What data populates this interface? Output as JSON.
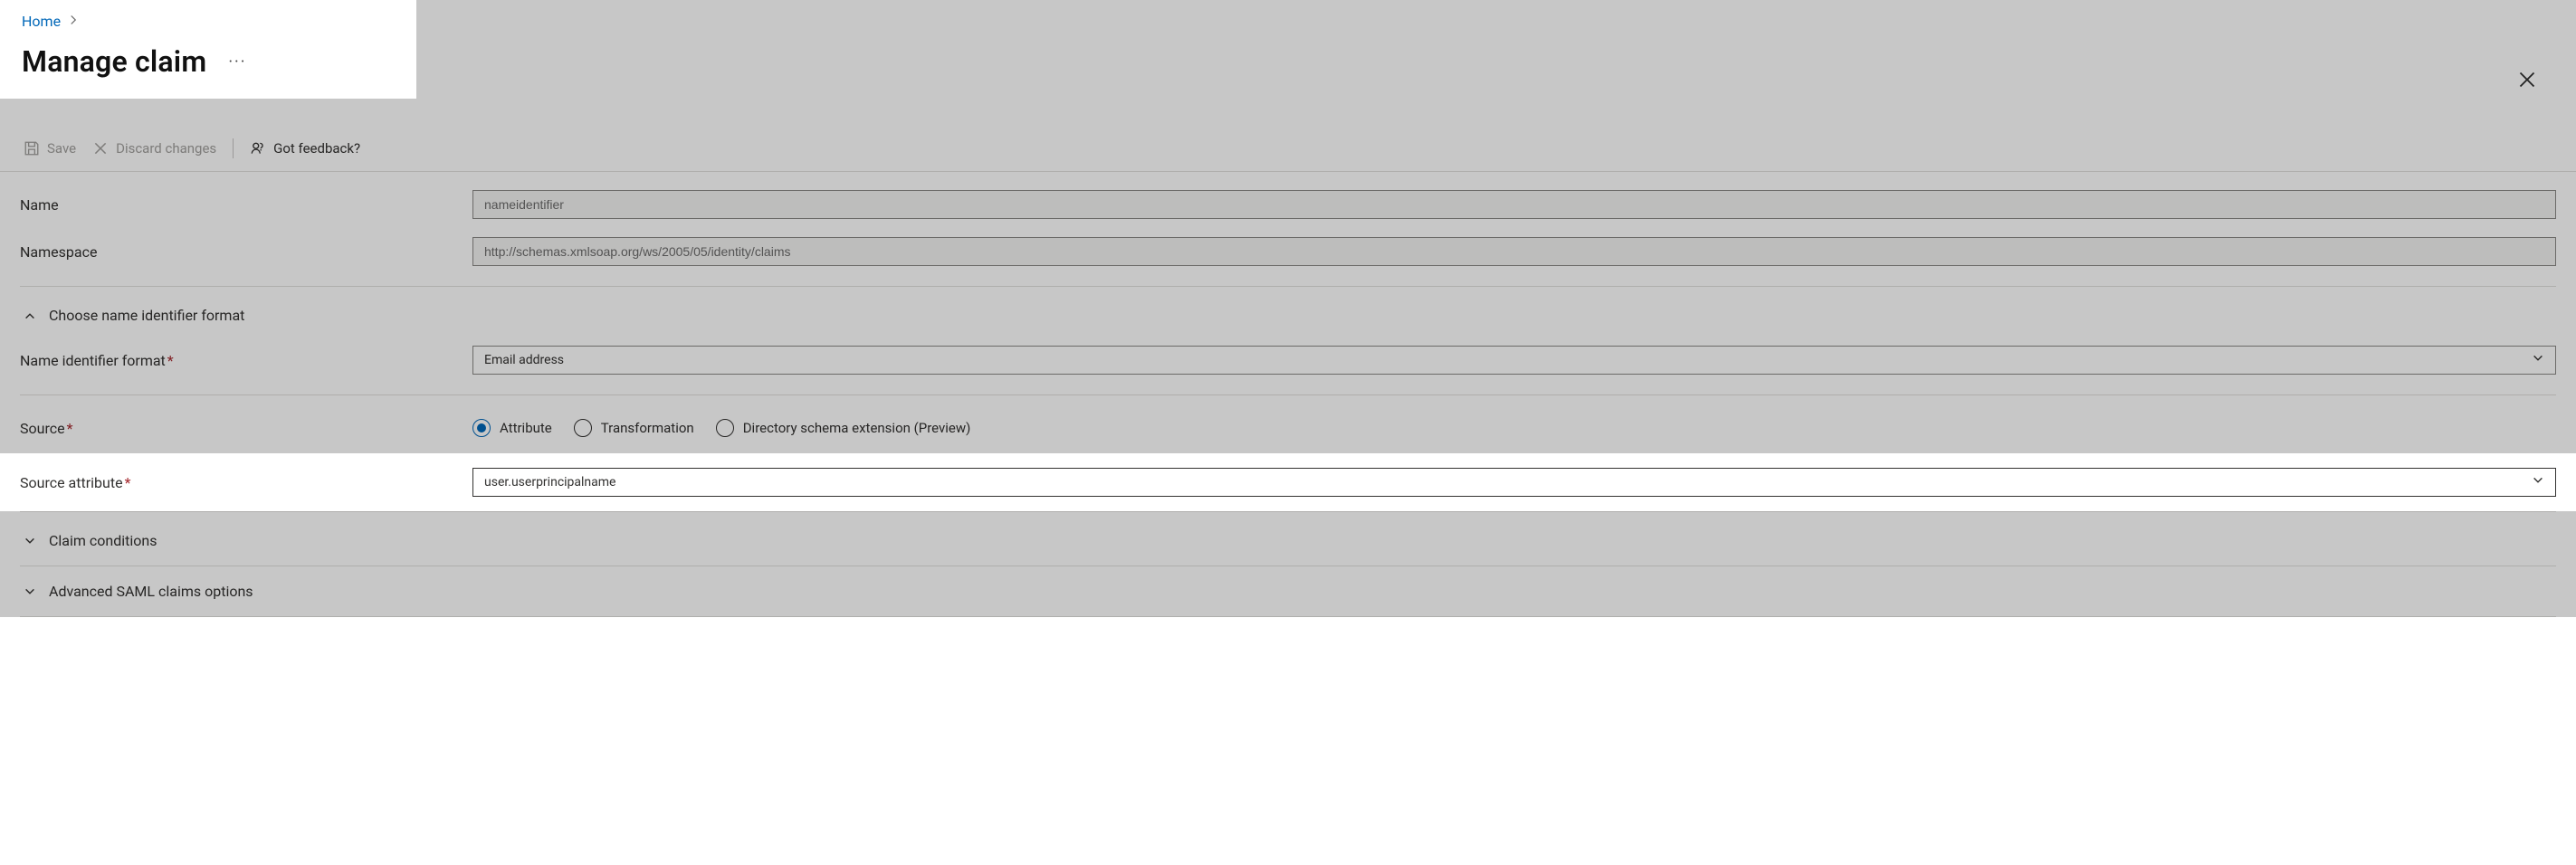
{
  "breadcrumb": {
    "home": "Home"
  },
  "title": "Manage claim",
  "toolbar": {
    "save": "Save",
    "discard": "Discard changes",
    "feedback": "Got feedback?"
  },
  "fields": {
    "name_label": "Name",
    "name_placeholder": "nameidentifier",
    "name_value": "",
    "namespace_label": "Namespace",
    "namespace_placeholder": "http://schemas.xmlsoap.org/ws/2005/05/identity/claims",
    "namespace_value": ""
  },
  "sections": {
    "choose_format": "Choose name identifier format",
    "name_id_format_label": "Name identifier format",
    "name_id_format_value": "Email address",
    "source_label": "Source",
    "source_options": {
      "attribute": "Attribute",
      "transformation": "Transformation",
      "directory_ext": "Directory schema extension (Preview)"
    },
    "source_selected": "attribute",
    "source_attribute_label": "Source attribute",
    "source_attribute_value": "user.userprincipalname",
    "claim_conditions": "Claim conditions",
    "advanced_saml": "Advanced SAML claims options"
  },
  "required_marker": "*"
}
